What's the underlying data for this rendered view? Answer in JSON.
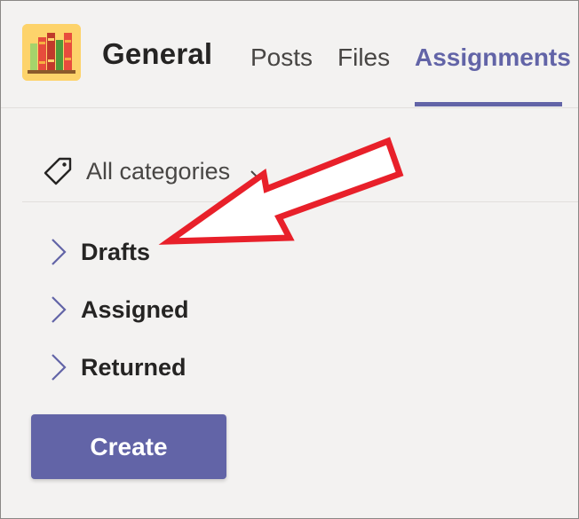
{
  "header": {
    "channel_name": "General",
    "tabs": [
      {
        "label": "Posts"
      },
      {
        "label": "Files"
      },
      {
        "label": "Assignments",
        "active": true
      }
    ]
  },
  "filter": {
    "label": "All categories",
    "icon": "tag-icon"
  },
  "sections": [
    {
      "label": "Drafts"
    },
    {
      "label": "Assigned"
    },
    {
      "label": "Returned"
    }
  ],
  "create_button": {
    "label": "Create"
  },
  "colors": {
    "accent": "#6264a7",
    "background": "#f3f2f1",
    "annotation_arrow": "#e8202a"
  }
}
